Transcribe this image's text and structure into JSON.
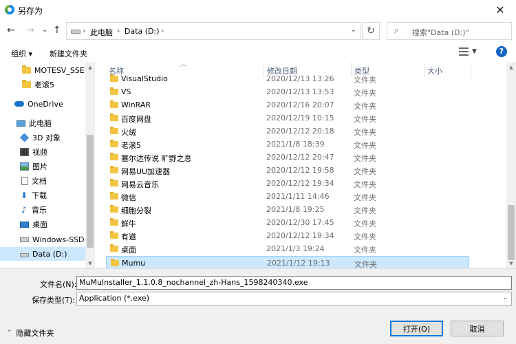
{
  "window": {
    "title": "另存为",
    "close_glyph": "✕"
  },
  "nav_buttons": {
    "back": "←",
    "forward": "→",
    "recent": "⌄",
    "up": "↑"
  },
  "address": {
    "breadcrumbs": [
      "此电脑",
      "Data (D:)"
    ],
    "separator": "›",
    "dropdown": "⌄",
    "refresh": "↻"
  },
  "search": {
    "placeholder": "搜索\"Data (D:)\"",
    "icon": "⌕"
  },
  "toolbar": {
    "organize": "组织 ▾",
    "new_folder": "新建文件夹",
    "help": "?"
  },
  "nav_pane": {
    "items": [
      {
        "label": "MOTESV_SSE",
        "icon": "folder-icon"
      },
      {
        "label": "老滚5",
        "icon": "folder-icon"
      },
      {
        "label": "OneDrive",
        "icon": "onedrive-cloud-icon"
      },
      {
        "label": "此电脑",
        "icon": "this-pc-icon"
      },
      {
        "label": "3D 对象",
        "icon": "3d-objects-icon"
      },
      {
        "label": "视频",
        "icon": "videos-icon"
      },
      {
        "label": "图片",
        "icon": "pictures-icon"
      },
      {
        "label": "文档",
        "icon": "documents-icon"
      },
      {
        "label": "下载",
        "icon": "downloads-icon"
      },
      {
        "label": "音乐",
        "icon": "music-icon"
      },
      {
        "label": "桌面",
        "icon": "desktop-icon"
      },
      {
        "label": "Windows-SSD (",
        "icon": "windows-drive-icon"
      },
      {
        "label": "Data (D:)",
        "icon": "drive-icon",
        "selected": true
      }
    ]
  },
  "columns": {
    "name": "名称",
    "modified": "修改日期",
    "type": "类型",
    "size": "大小"
  },
  "files": [
    {
      "name": "VisualStudio",
      "modified": "2020/12/13 13:26",
      "type": "文件夹"
    },
    {
      "name": "VS",
      "modified": "2020/12/13 13:53",
      "type": "文件夹"
    },
    {
      "name": "WinRAR",
      "modified": "2020/12/16 20:07",
      "type": "文件夹"
    },
    {
      "name": "百度网盘",
      "modified": "2020/12/19 10:15",
      "type": "文件夹"
    },
    {
      "name": "火绒",
      "modified": "2020/12/12 20:18",
      "type": "文件夹"
    },
    {
      "name": "老滚5",
      "modified": "2021/1/8 18:39",
      "type": "文件夹"
    },
    {
      "name": "塞尔达传说 旷野之息",
      "modified": "2020/12/12 20:47",
      "type": "文件夹"
    },
    {
      "name": "网易UU加速器",
      "modified": "2020/12/12 19:58",
      "type": "文件夹"
    },
    {
      "name": "网易云音乐",
      "modified": "2020/12/12 19:34",
      "type": "文件夹"
    },
    {
      "name": "微信",
      "modified": "2021/1/11 14:46",
      "type": "文件夹"
    },
    {
      "name": "细胞分裂",
      "modified": "2021/1/8 19:25",
      "type": "文件夹"
    },
    {
      "name": "鲜牛",
      "modified": "2020/12/30 17:45",
      "type": "文件夹"
    },
    {
      "name": "有道",
      "modified": "2020/12/12 19:34",
      "type": "文件夹"
    },
    {
      "name": "桌面",
      "modified": "2021/1/3 19:24",
      "type": "文件夹"
    },
    {
      "name": "Mumu",
      "modified": "2021/1/12 19:13",
      "type": "文件夹",
      "selected": true
    }
  ],
  "form": {
    "filename_label": "文件名(N):",
    "filename_value": "MuMuInstaller_1.1.0.8_nochannel_zh-Hans_1598240340.exe",
    "filetype_label": "保存类型(T):",
    "filetype_value": "Application (*.exe)",
    "hide_folders": "隐藏文件夹",
    "open_button": "打开(O)",
    "cancel_button": "取消"
  }
}
